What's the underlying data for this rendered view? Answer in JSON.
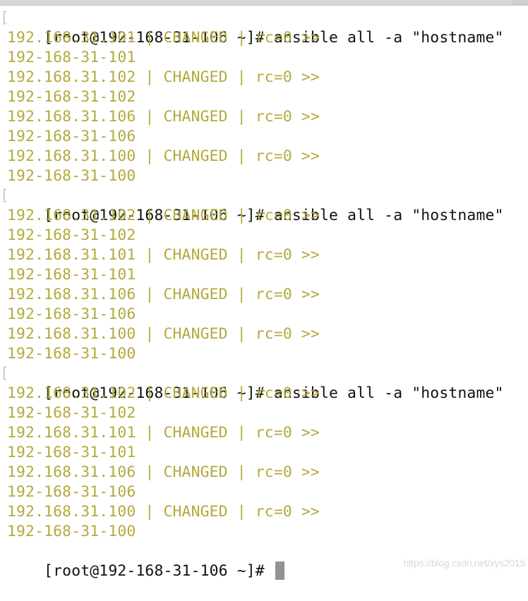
{
  "window": {
    "title_bar": ""
  },
  "terminal": {
    "prompt": "[root@192-168-31-106 ~]#",
    "sessions": [
      {
        "command": "[root@192-168-31-106 ~]# ansible all -a \"hostname\"",
        "results": [
          {
            "header": "192.168.31.101 | CHANGED | rc=0 >>",
            "output": "192-168-31-101"
          },
          {
            "header": "192.168.31.102 | CHANGED | rc=0 >>",
            "output": "192-168-31-102"
          },
          {
            "header": "192.168.31.106 | CHANGED | rc=0 >>",
            "output": "192-168-31-106"
          },
          {
            "header": "192.168.31.100 | CHANGED | rc=0 >>",
            "output": "192-168-31-100"
          }
        ]
      },
      {
        "command": "[root@192-168-31-106 ~]# ansible all -a \"hostname\"",
        "results": [
          {
            "header": "192.168.31.102 | CHANGED | rc=0 >>",
            "output": "192-168-31-102"
          },
          {
            "header": "192.168.31.101 | CHANGED | rc=0 >>",
            "output": "192-168-31-101"
          },
          {
            "header": "192.168.31.106 | CHANGED | rc=0 >>",
            "output": "192-168-31-106"
          },
          {
            "header": "192.168.31.100 | CHANGED | rc=0 >>",
            "output": "192-168-31-100"
          }
        ]
      },
      {
        "command": "[root@192-168-31-106 ~]# ansible all -a \"hostname\"",
        "results": [
          {
            "header": "192.168.31.102 | CHANGED | rc=0 >>",
            "output": "192-168-31-102"
          },
          {
            "header": "192.168.31.101 | CHANGED | rc=0 >>",
            "output": "192-168-31-101"
          },
          {
            "header": "192.168.31.106 | CHANGED | rc=0 >>",
            "output": "192-168-31-106"
          },
          {
            "header": "192.168.31.100 | CHANGED | rc=0 >>",
            "output": "192-168-31-100"
          }
        ]
      }
    ],
    "mark_glyph": "[",
    "current_input": ""
  },
  "watermark": "https://blog.csdn.net/xys2015",
  "colors": {
    "command_text": "#111111",
    "output_text": "#b3aa3c",
    "cursor": "#939393",
    "background": "#ffffff"
  }
}
